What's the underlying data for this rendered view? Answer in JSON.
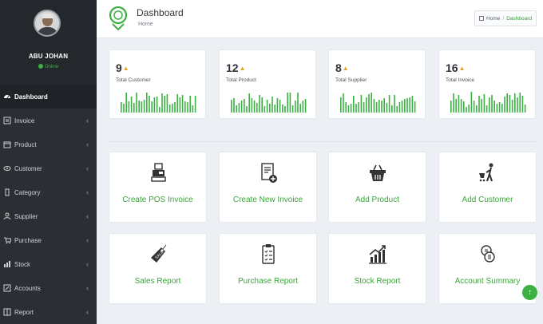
{
  "user": {
    "name": "ABU JOHAN",
    "status": "Online"
  },
  "sidebar": {
    "items": [
      {
        "label": "Dashboard",
        "icon": "dashboard-icon",
        "active": true
      },
      {
        "label": "Invoice",
        "icon": "invoice-icon"
      },
      {
        "label": "Product",
        "icon": "product-icon"
      },
      {
        "label": "Customer",
        "icon": "customer-icon"
      },
      {
        "label": "Category",
        "icon": "category-icon"
      },
      {
        "label": "Supplier",
        "icon": "supplier-icon"
      },
      {
        "label": "Purchase",
        "icon": "purchase-icon"
      },
      {
        "label": "Stock",
        "icon": "stock-icon"
      },
      {
        "label": "Accounts",
        "icon": "accounts-icon"
      },
      {
        "label": "Report",
        "icon": "report-icon"
      }
    ]
  },
  "header": {
    "title": "Dashboard",
    "subtitle": "Home",
    "breadcrumb": {
      "home": "Home",
      "current": "Dashboard"
    }
  },
  "stats": [
    {
      "value": "9",
      "label": "Total Customer"
    },
    {
      "value": "12",
      "label": "Total Product"
    },
    {
      "value": "8",
      "label": "Total Supplier"
    },
    {
      "value": "16",
      "label": "Total Invoice"
    }
  ],
  "actions": [
    {
      "label": "Create POS Invoice",
      "icon": "pos-invoice-icon"
    },
    {
      "label": "Create New Invoice",
      "icon": "new-invoice-icon"
    },
    {
      "label": "Add Product",
      "icon": "basket-icon"
    },
    {
      "label": "Add Customer",
      "icon": "customer-cart-icon"
    },
    {
      "label": "Sales Report",
      "icon": "sales-tag-icon"
    },
    {
      "label": "Purchase Report",
      "icon": "clipboard-icon"
    },
    {
      "label": "Stock Report",
      "icon": "stock-chart-icon"
    },
    {
      "label": "Account Summary",
      "icon": "coins-icon"
    }
  ],
  "colors": {
    "accent": "#3cb043",
    "sidebar": "#2b2f34",
    "up_arrow": "#e5a11d"
  }
}
